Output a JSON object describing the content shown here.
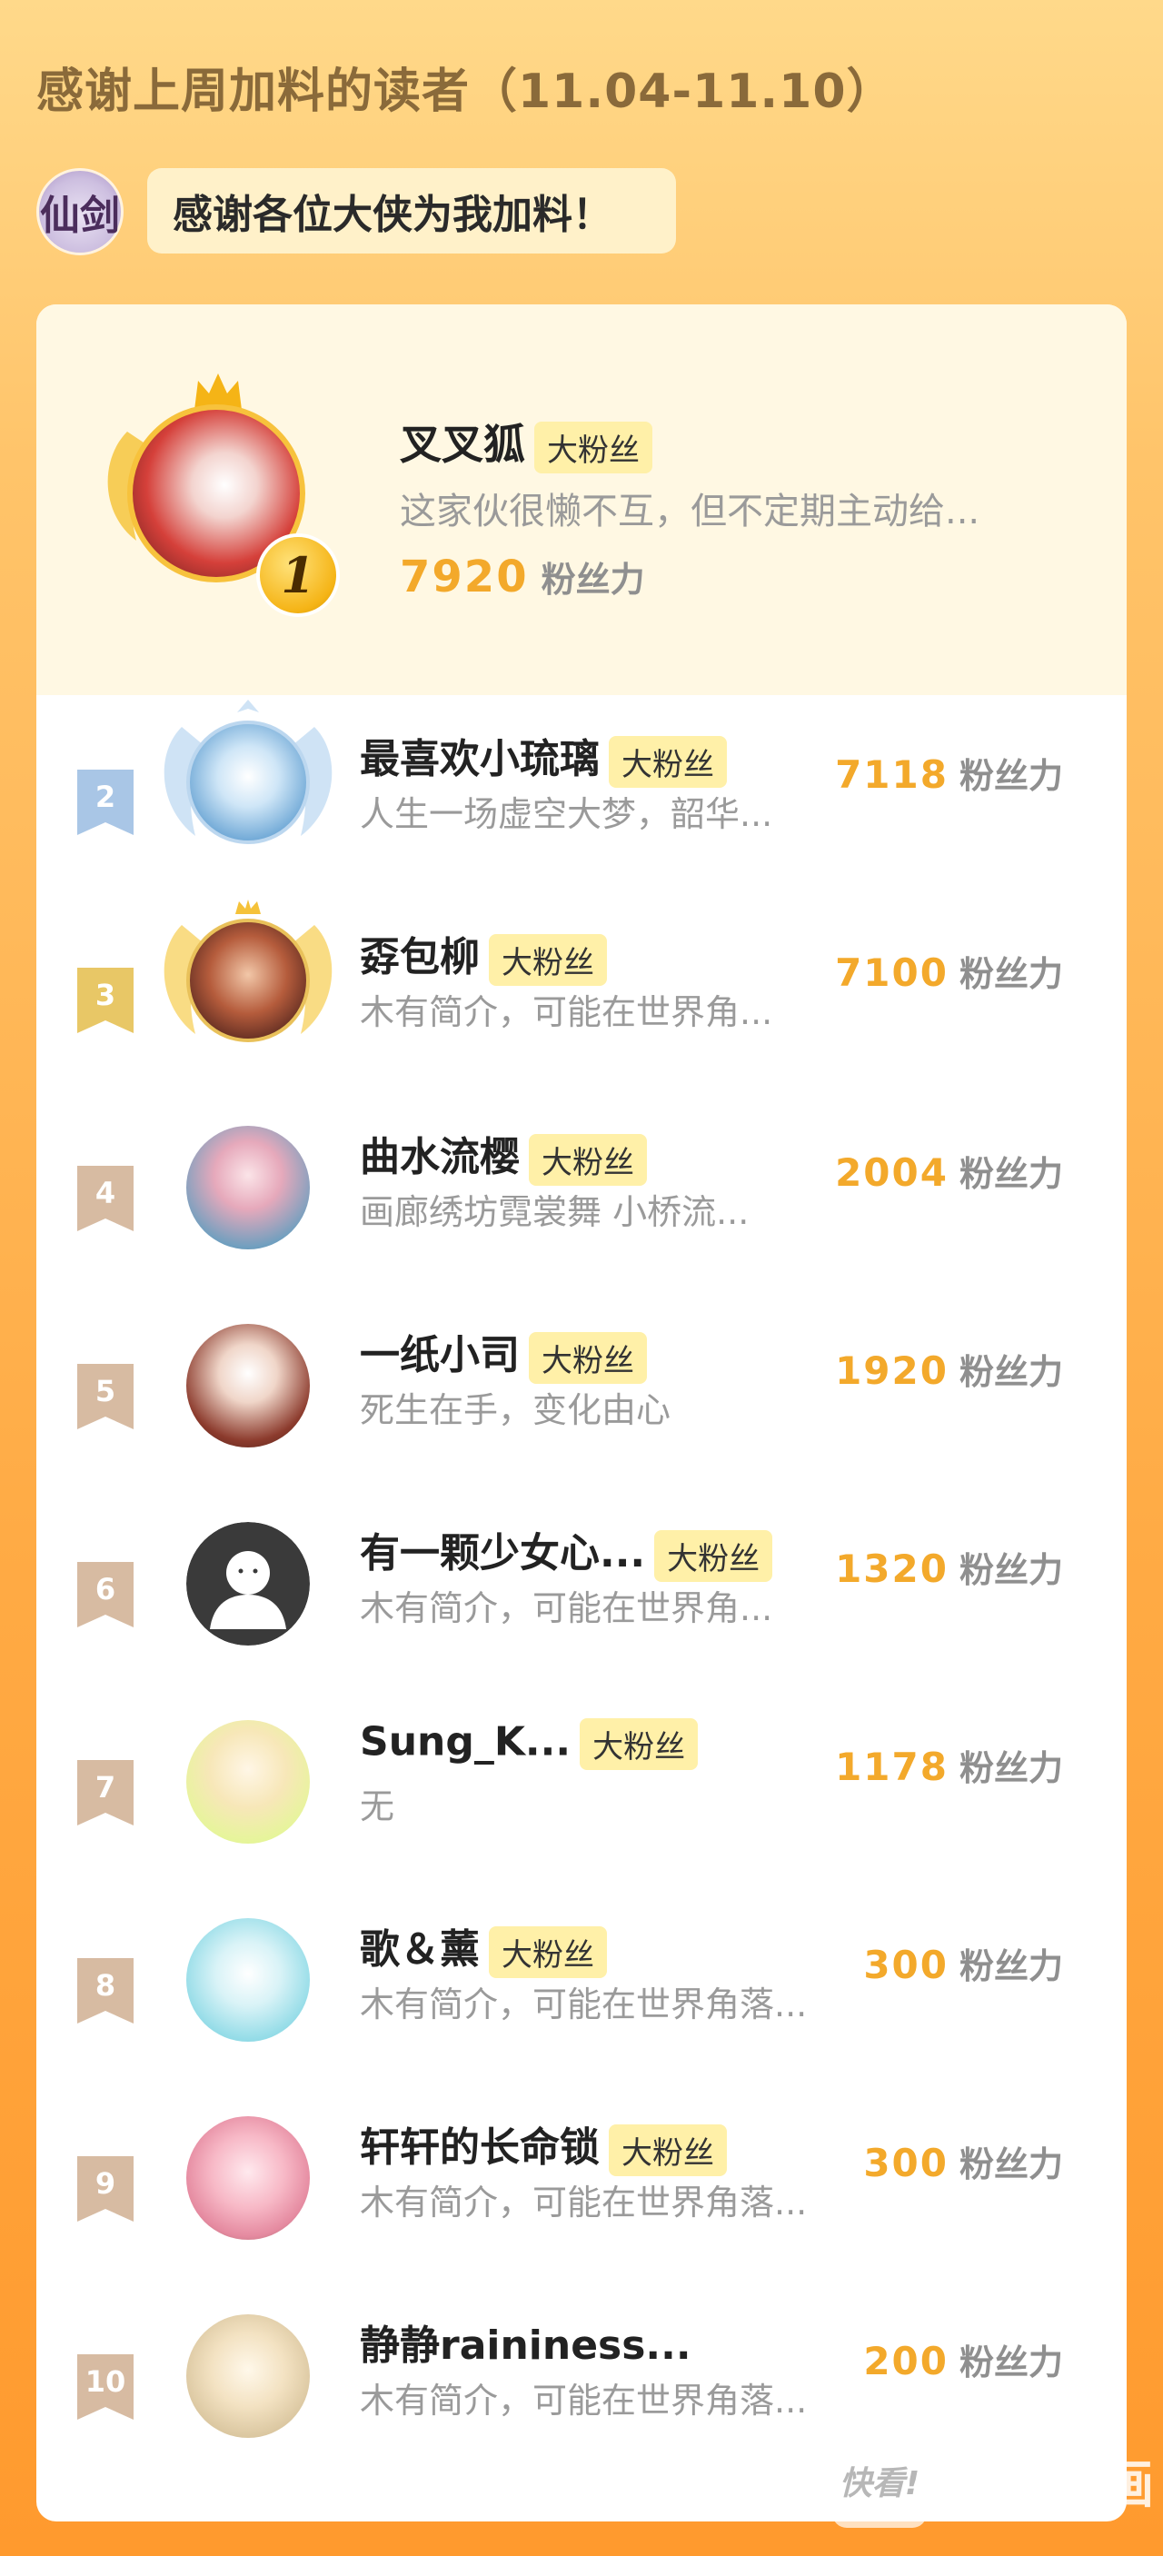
{
  "header": {
    "title": "感谢上周加料的读者（11.04-11.10）",
    "app_avatar_text": "仙剑",
    "bubble_text": "感谢各位大侠为我加料！"
  },
  "top_fan": {
    "rank": "1",
    "name": "叉叉狐",
    "badge": "大粉丝",
    "bio": "这家伙很懒不互，但不定期主动给...",
    "score": "7920",
    "unit": "粉丝力"
  },
  "list": [
    {
      "rank": "2",
      "name": "最喜欢小琉璃",
      "badge": "大粉丝",
      "bio": "人生一场虚空大梦，韶华...",
      "score": "7118",
      "unit": "粉丝力"
    },
    {
      "rank": "3",
      "name": "孬包柳",
      "badge": "大粉丝",
      "bio": "木有简介，可能在世界角...",
      "score": "7100",
      "unit": "粉丝力"
    },
    {
      "rank": "4",
      "name": "曲水流樱",
      "badge": "大粉丝",
      "bio": "画廊绣坊霓裳舞 小桥流...",
      "score": "2004",
      "unit": "粉丝力"
    },
    {
      "rank": "5",
      "name": "一纸小司",
      "badge": "大粉丝",
      "bio": "死生在手，变化由心",
      "score": "1920",
      "unit": "粉丝力"
    },
    {
      "rank": "6",
      "name": "有一颗少女心...",
      "badge": "大粉丝",
      "bio": "木有简介，可能在世界角...",
      "score": "1320",
      "unit": "粉丝力"
    },
    {
      "rank": "7",
      "name": "Sung_K...",
      "badge": "大粉丝",
      "bio": "无",
      "score": "1178",
      "unit": "粉丝力"
    },
    {
      "rank": "8",
      "name": "歌＆薰",
      "badge": "大粉丝",
      "bio": "木有简介，可能在世界角落...",
      "score": "300",
      "unit": "粉丝力"
    },
    {
      "rank": "9",
      "name": "轩轩的长命锁",
      "badge": "大粉丝",
      "bio": "木有简介，可能在世界角落...",
      "score": "300",
      "unit": "粉丝力"
    },
    {
      "rank": "10",
      "name": "静静raininess...",
      "badge": "",
      "bio": "木有简介，可能在世界角落...",
      "score": "200",
      "unit": "粉丝力"
    }
  ],
  "watermark": {
    "logo_text": "快看!",
    "text": "快看漫画"
  },
  "colors": {
    "score": "#f3a92b",
    "rank2_flag": "#a9c6e6",
    "rank3_flag": "#e8c766",
    "rank_other_flag": "#d7bba2",
    "badge_bg": "#fff0a8"
  }
}
